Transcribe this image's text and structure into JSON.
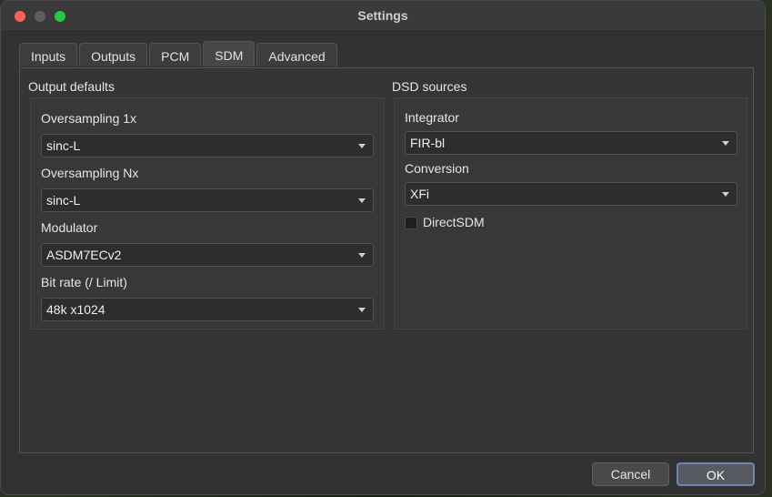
{
  "window": {
    "title": "Settings"
  },
  "tabs": [
    {
      "label": "Inputs"
    },
    {
      "label": "Outputs"
    },
    {
      "label": "PCM"
    },
    {
      "label": "SDM",
      "active": true
    },
    {
      "label": "Advanced"
    }
  ],
  "output_defaults": {
    "title": "Output defaults",
    "fields": [
      {
        "label": "Oversampling 1x",
        "value": "sinc-L"
      },
      {
        "label": "Oversampling Nx",
        "value": "sinc-L"
      },
      {
        "label": "Modulator",
        "value": "ASDM7ECv2"
      },
      {
        "label": "Bit rate (/ Limit)",
        "value": "48k x1024"
      }
    ]
  },
  "dsd_sources": {
    "title": "DSD sources",
    "fields": [
      {
        "label": "Integrator",
        "value": "FIR-bl"
      },
      {
        "label": "Conversion",
        "value": "XFi"
      }
    ],
    "checkbox": {
      "label": "DirectSDM",
      "checked": false
    }
  },
  "buttons": {
    "cancel": "Cancel",
    "ok": "OK"
  },
  "colors": {
    "window_bg": "#323232",
    "accent_focus": "#6c88b0",
    "traffic_red": "#ff5f57",
    "traffic_green": "#28c840"
  }
}
